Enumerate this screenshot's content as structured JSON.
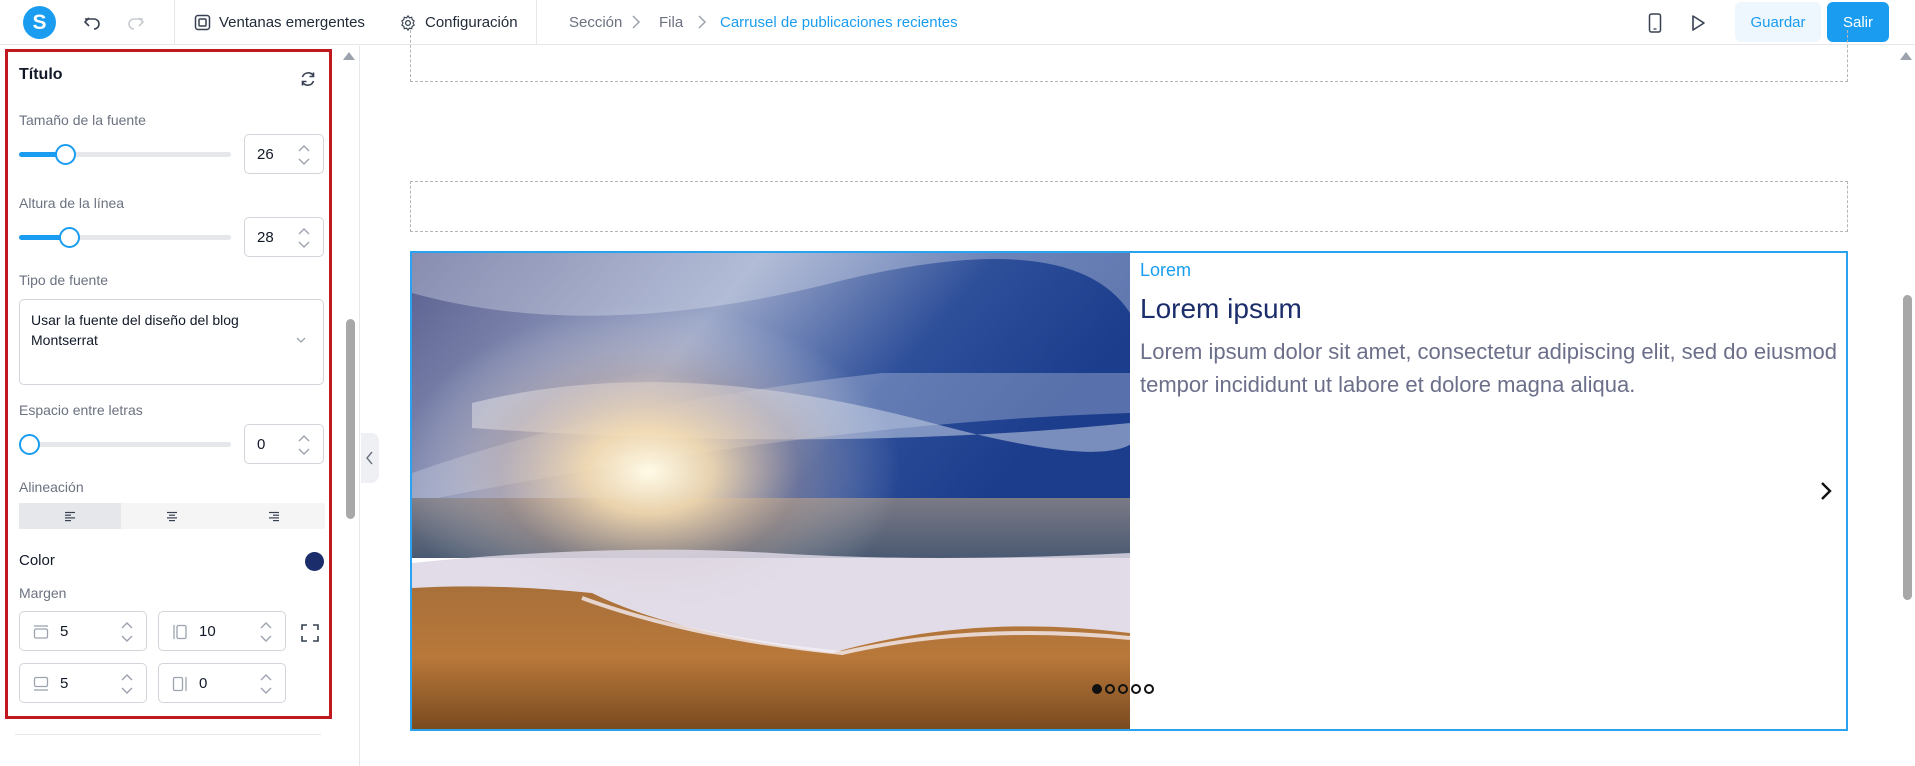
{
  "app": {
    "logo_letter": "S",
    "accent": "#1a9df0"
  },
  "toolbar": {
    "popups_label": "Ventanas emergentes",
    "settings_label": "Configuración",
    "save_label": "Guardar",
    "exit_label": "Salir"
  },
  "breadcrumb": [
    "Sección",
    "Fila",
    "Carrusel de publicaciones recientes"
  ],
  "panel": {
    "title": "Título",
    "font_size": {
      "label": "Tamaño de la fuente",
      "value": "26",
      "level": 0.2
    },
    "line_height": {
      "label": "Altura de la línea",
      "value": "28",
      "level": 0.21
    },
    "font_type": {
      "label": "Tipo de fuente",
      "line1": "Usar la fuente del diseño del blog",
      "line2": "Montserrat"
    },
    "letter_spacing": {
      "label": "Espacio entre letras",
      "value": "0",
      "level": 0
    },
    "alignment": {
      "label": "Alineación",
      "selected": "left"
    },
    "color": {
      "label": "Color",
      "value": "#1b2d6b"
    },
    "margin": {
      "label": "Margen",
      "top": "5",
      "right": "10",
      "bottom": "5",
      "left": "0"
    }
  },
  "carousel": {
    "category": "Lorem",
    "title": "Lorem ipsum",
    "excerpt": "Lorem ipsum dolor sit amet, consectetur adipiscing elit, sed do eiusmod tempor incididunt ut labore et dolore magna aliqua.",
    "slides": 5,
    "active_slide": 0,
    "border_color": "#2aa2ef"
  }
}
